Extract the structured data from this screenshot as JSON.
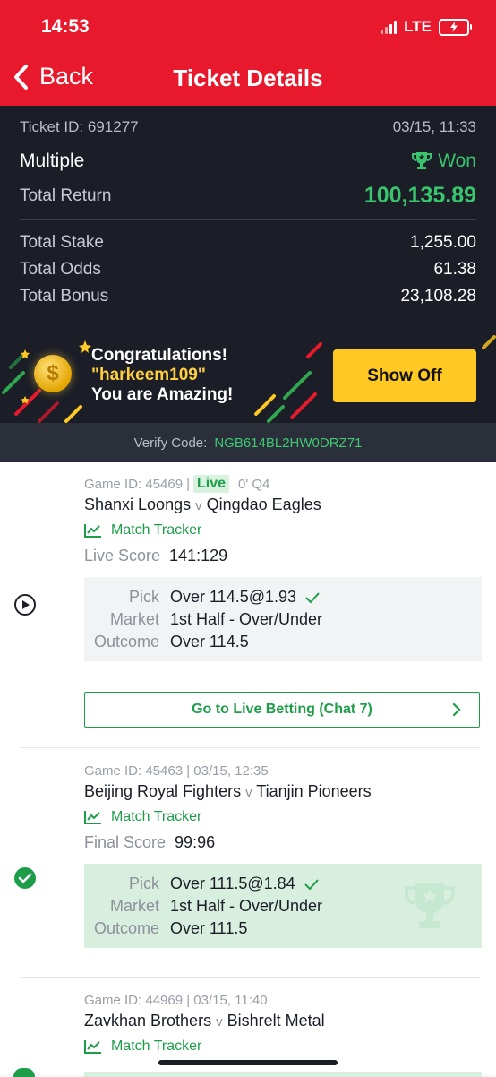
{
  "status_bar": {
    "time": "14:53",
    "network": "LTE"
  },
  "header": {
    "back_label": "Back",
    "title": "Ticket Details"
  },
  "ticket": {
    "id_label": "Ticket ID: 691277",
    "datetime": "03/15, 11:33",
    "type": "Multiple",
    "status": "Won",
    "total_return_label": "Total Return",
    "total_return": "100,135.89",
    "total_stake_label": "Total Stake",
    "total_stake": "1,255.00",
    "total_odds_label": "Total Odds",
    "total_odds": "61.38",
    "total_bonus_label": "Total Bonus",
    "total_bonus": "23,108.28"
  },
  "banner": {
    "line1": "Congratulations!",
    "username": "\"harkeem109\"",
    "line3": "You are Amazing!",
    "show_off_label": "Show Off"
  },
  "verify": {
    "label": "Verify Code:",
    "code": "NGB614BL2HW0DRZ71"
  },
  "games": [
    {
      "game_id": "Game ID: 45469",
      "sep": "|",
      "live": "Live",
      "time_info": "0' Q4",
      "home": "Shanxi Loongs",
      "vs": "v",
      "away": "Qingdao Eagles",
      "tracker_label": "Match Tracker",
      "score_label": "Live Score",
      "score": "141:129",
      "pick_label": "Pick",
      "pick": "Over 114.5@1.93",
      "market_label": "Market",
      "market": "1st Half - Over/Under",
      "outcome_label": "Outcome",
      "outcome": "Over 114.5",
      "live_betting_label": "Go to Live Betting (Chat 7)"
    },
    {
      "game_id": "Game ID: 45463 | 03/15, 12:35",
      "home": "Beijing Royal Fighters",
      "vs": "v",
      "away": "Tianjin Pioneers",
      "tracker_label": "Match Tracker",
      "score_label": "Final Score",
      "score": "99:96",
      "pick_label": "Pick",
      "pick": "Over 111.5@1.84",
      "market_label": "Market",
      "market": "1st Half - Over/Under",
      "outcome_label": "Outcome",
      "outcome": "Over 111.5"
    },
    {
      "game_id": "Game ID: 44969 | 03/15, 11:40",
      "home": "Zavkhan Brothers",
      "vs": "v",
      "away": "Bishrelt Metal",
      "tracker_label": "Match Tracker"
    }
  ],
  "colors": {
    "brand_red": "#e8192c",
    "win_green": "#39c46d",
    "accent_yellow": "#ffc823",
    "dark_bg": "#1b1e27"
  }
}
